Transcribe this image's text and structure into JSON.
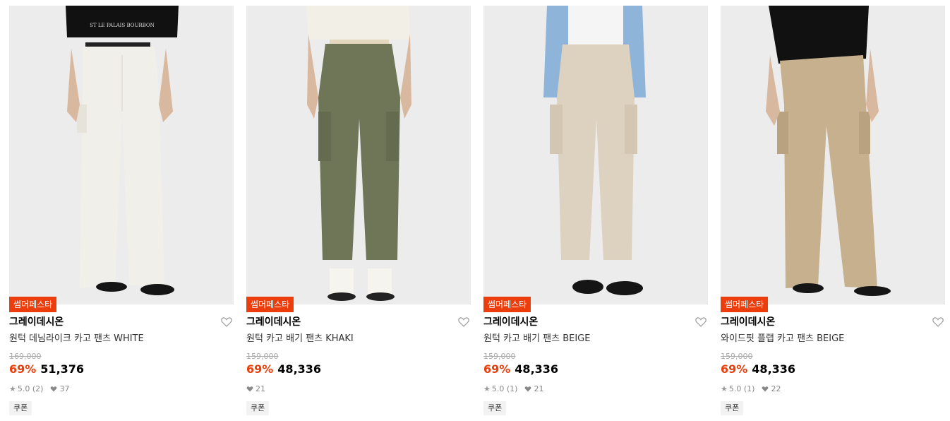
{
  "products": [
    {
      "badge": "썸머페스타",
      "brand": "그레이데시온",
      "name": "원턱 데님라이크 카고 팬츠 WHITE",
      "original_price": "169,000",
      "discount": "69%",
      "sale_price": "51,376",
      "rating": "5.0 (2)",
      "likes": "37",
      "coupon": "쿠폰",
      "colors": {
        "pants": "#f1efe9",
        "top": "#111111",
        "bg": "#ececec"
      }
    },
    {
      "badge": "썸머페스타",
      "brand": "그레이데시온",
      "name": "원턱 카고 배기 팬츠 KHAKI",
      "original_price": "159,000",
      "discount": "69%",
      "sale_price": "48,336",
      "rating": "",
      "likes": "21",
      "coupon": "쿠폰",
      "colors": {
        "pants": "#6f7557",
        "top": "#f2efe7",
        "bg": "#ececec"
      }
    },
    {
      "badge": "썸머페스타",
      "brand": "그레이데시온",
      "name": "원턱 카고 배기 팬츠 BEIGE",
      "original_price": "159,000",
      "discount": "69%",
      "sale_price": "48,336",
      "rating": "5.0 (1)",
      "likes": "21",
      "coupon": "쿠폰",
      "colors": {
        "pants": "#ddd1bf",
        "top": "#8fb4d9",
        "bg": "#ececec"
      }
    },
    {
      "badge": "썸머페스타",
      "brand": "그레이데시온",
      "name": "와이드핏 플랩 카고 팬츠 BEIGE",
      "original_price": "159,000",
      "discount": "69%",
      "sale_price": "48,336",
      "rating": "5.0 (1)",
      "likes": "22",
      "coupon": "쿠폰",
      "colors": {
        "pants": "#c6b08e",
        "top": "#111111",
        "bg": "#ececec"
      }
    }
  ],
  "icons": {
    "heart": "heart-outline-icon",
    "star": "star-icon",
    "like": "heart-filled-icon"
  }
}
